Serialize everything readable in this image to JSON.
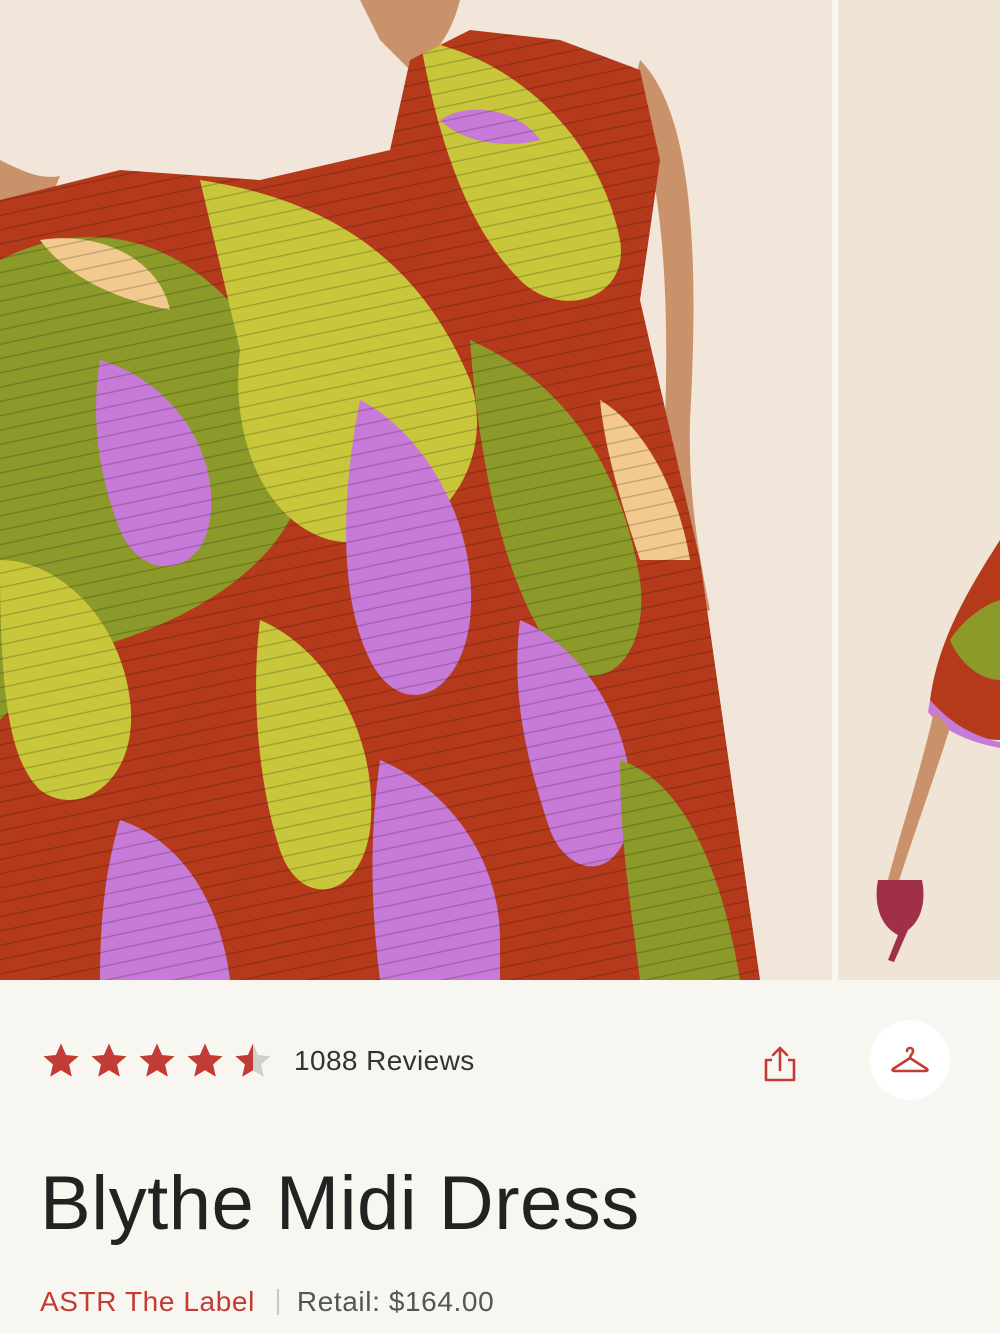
{
  "gallery": {
    "images": [
      {
        "name": "product-photo-main",
        "icon": "model-in-tropical-print-dress"
      },
      {
        "name": "product-photo-second",
        "icon": "model-back-view-heels"
      }
    ],
    "colors": {
      "background": "#f1e6d9",
      "rust": "#b53a1c",
      "olive": "#8c9a2a",
      "chartreuse": "#c8c63a",
      "lilac": "#c77ad8",
      "peach": "#f2c98e",
      "skin": "#c9926a"
    }
  },
  "product": {
    "rating": 4.5,
    "rating_max": 5,
    "reviews_label": "1088 Reviews",
    "title": "Blythe Midi Dress",
    "brand": "ASTR The Label",
    "retail": "Retail: $164.00"
  },
  "actions": {
    "share_icon": "share-icon",
    "closet_icon": "hanger-icon"
  },
  "colors": {
    "accent": "#c23b34",
    "star": "#c23b34",
    "star_empty": "#cfcfcf",
    "page_bg": "#f7f6f1"
  }
}
